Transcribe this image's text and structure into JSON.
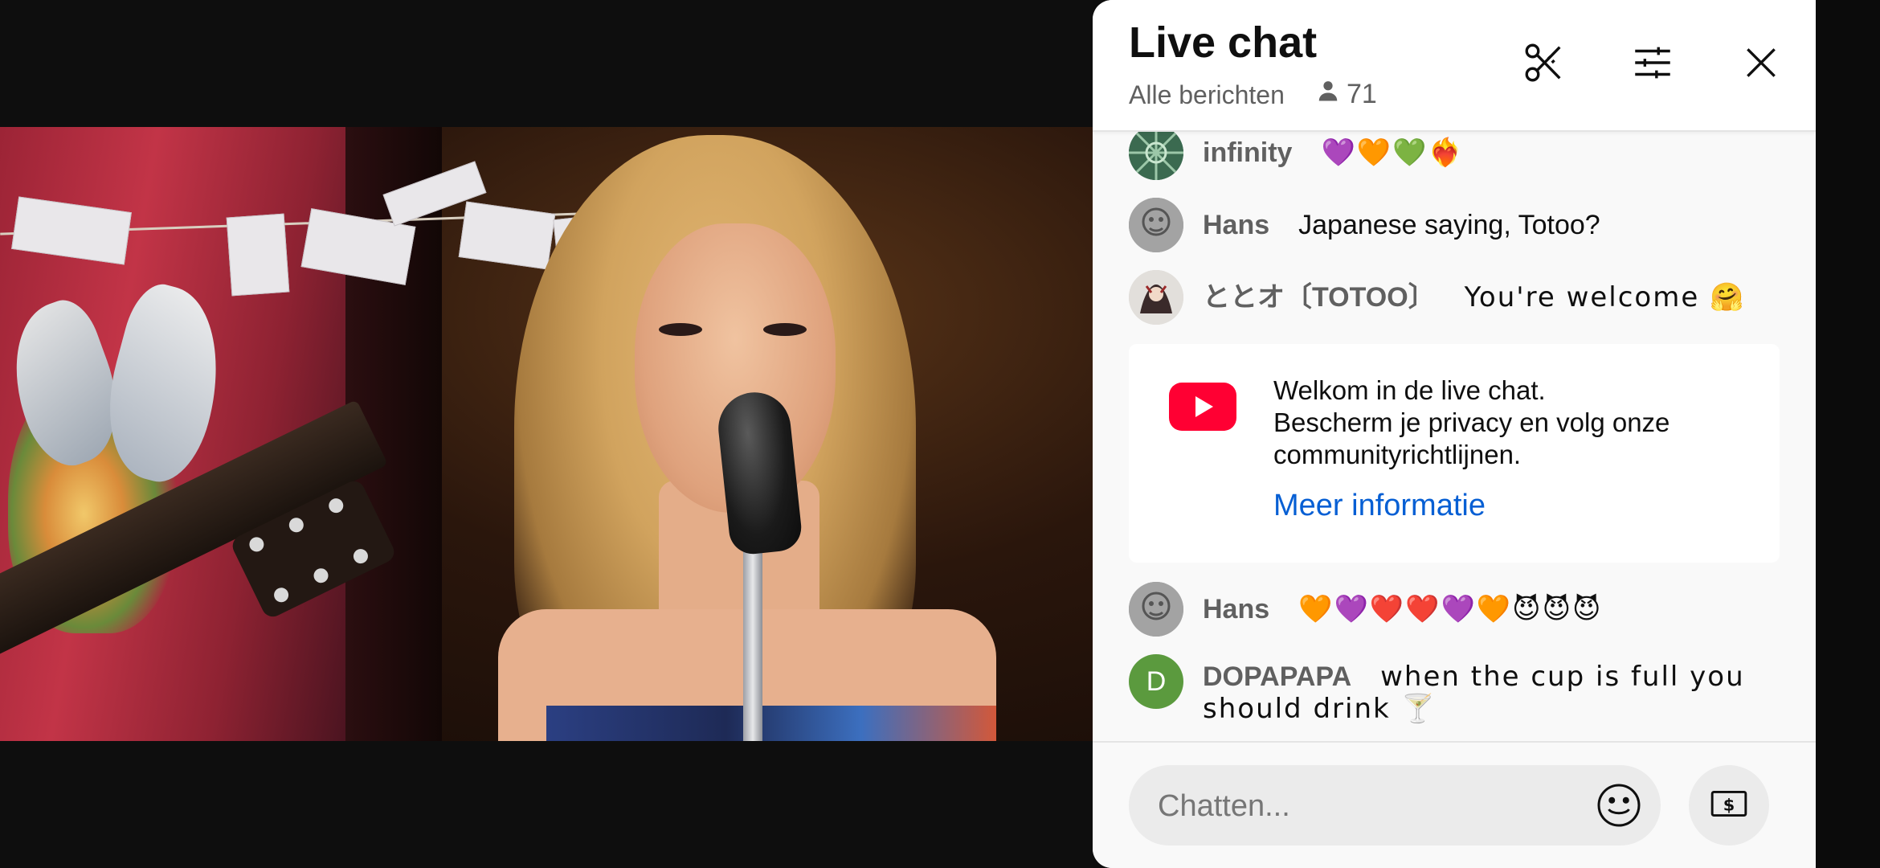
{
  "chat": {
    "title": "Live chat",
    "filter_label": "Alle berichten",
    "viewer_count": "71"
  },
  "messages": [
    {
      "author": "infinity",
      "text": "💜🧡💚❤️‍🔥"
    },
    {
      "author": "Hans",
      "text": "Japanese saying, Totoo?"
    },
    {
      "author": "ととオ〔TOTOO〕",
      "text": "You're welcome 🤗"
    },
    {
      "author": "Hans",
      "text": "🧡💜❤️❤️💜🧡😈😈😈"
    },
    {
      "author": "DOPAPAPA",
      "text": "when the cup is full you should drink 🍸",
      "avatar_letter": "D"
    }
  ],
  "welcome": {
    "line1": "Welkom in de live chat.",
    "line2": "Bescherm je privacy en volg onze communityrichtlijnen.",
    "link": "Meer informatie"
  },
  "input": {
    "placeholder": "Chatten..."
  },
  "colors": {
    "link": "#065fd4",
    "youtube_red": "#ff0033",
    "avatar_green": "#5b9a3e"
  },
  "icons": {
    "clip": "scissors-icon",
    "settings": "sliders-icon",
    "close": "close-icon",
    "viewers": "person-icon",
    "emoji": "smiley-icon",
    "superchat": "dollar-icon"
  }
}
